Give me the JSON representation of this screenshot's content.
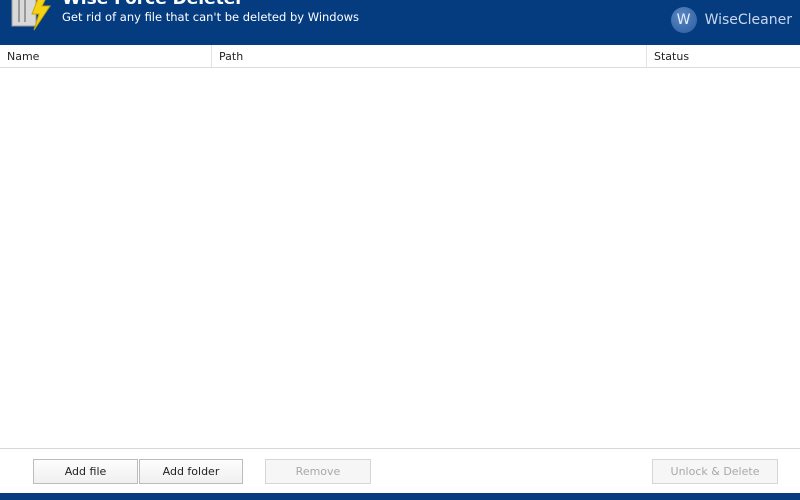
{
  "header": {
    "title": "Wise Force Deleter",
    "subtitle": "Get rid of any file that can't be deleted by Windows",
    "brand_letter": "W",
    "brand_name": "WiseCleaner"
  },
  "columns": [
    "Name",
    "Path",
    "Status"
  ],
  "buttons": {
    "add_file": "Add file",
    "add_folder": "Add folder",
    "remove": "Remove",
    "unlock_delete": "Unlock & Delete"
  },
  "colors": {
    "header": "#053c80"
  }
}
